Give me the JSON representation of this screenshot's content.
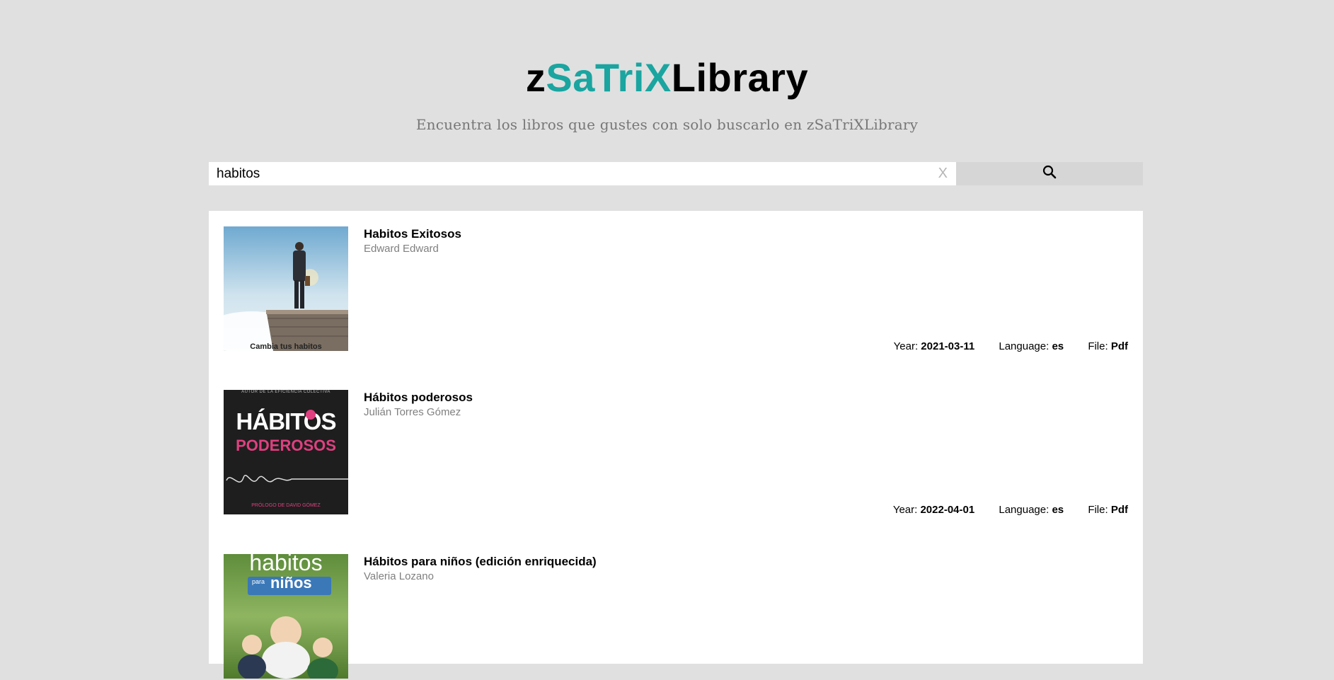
{
  "header": {
    "logo_prefix": "z",
    "logo_accent": "SaTriX",
    "logo_suffix": "Library",
    "tagline": "Encuentra los libros que gustes con solo buscarlo en zSaTriXLibrary"
  },
  "search": {
    "value": "habitos",
    "clear_label": "X",
    "button_icon": "search-icon"
  },
  "meta_labels": {
    "year": "Year: ",
    "language": "Language: ",
    "file": "File: "
  },
  "results": [
    {
      "title": "Habitos Exitosos",
      "author": "Edward Edward",
      "cover_text": "Cambia tus habitos",
      "year": "2021-03-11",
      "language": "es",
      "file": "Pdf"
    },
    {
      "title": "Hábitos poderosos",
      "author": "Julián Torres Gómez",
      "cover_text_top": "AUTOR DE LA EFICIENCIA COLECTIVA",
      "cover_text_1": "HÁBITOS",
      "cover_text_2": "PODEROSOS",
      "cover_text_bottom": "PRÓLOGO DE DAVID GÓMEZ",
      "year": "2022-04-01",
      "language": "es",
      "file": "Pdf"
    },
    {
      "title": "Hábitos para niños (edición enriquecida)",
      "author": "Valeria Lozano",
      "cover_text_1": "habitos",
      "cover_text_2": "para",
      "cover_text_3": "niños"
    }
  ],
  "colors": {
    "accent": "#1aa5a0",
    "background": "#e0e0e0"
  }
}
